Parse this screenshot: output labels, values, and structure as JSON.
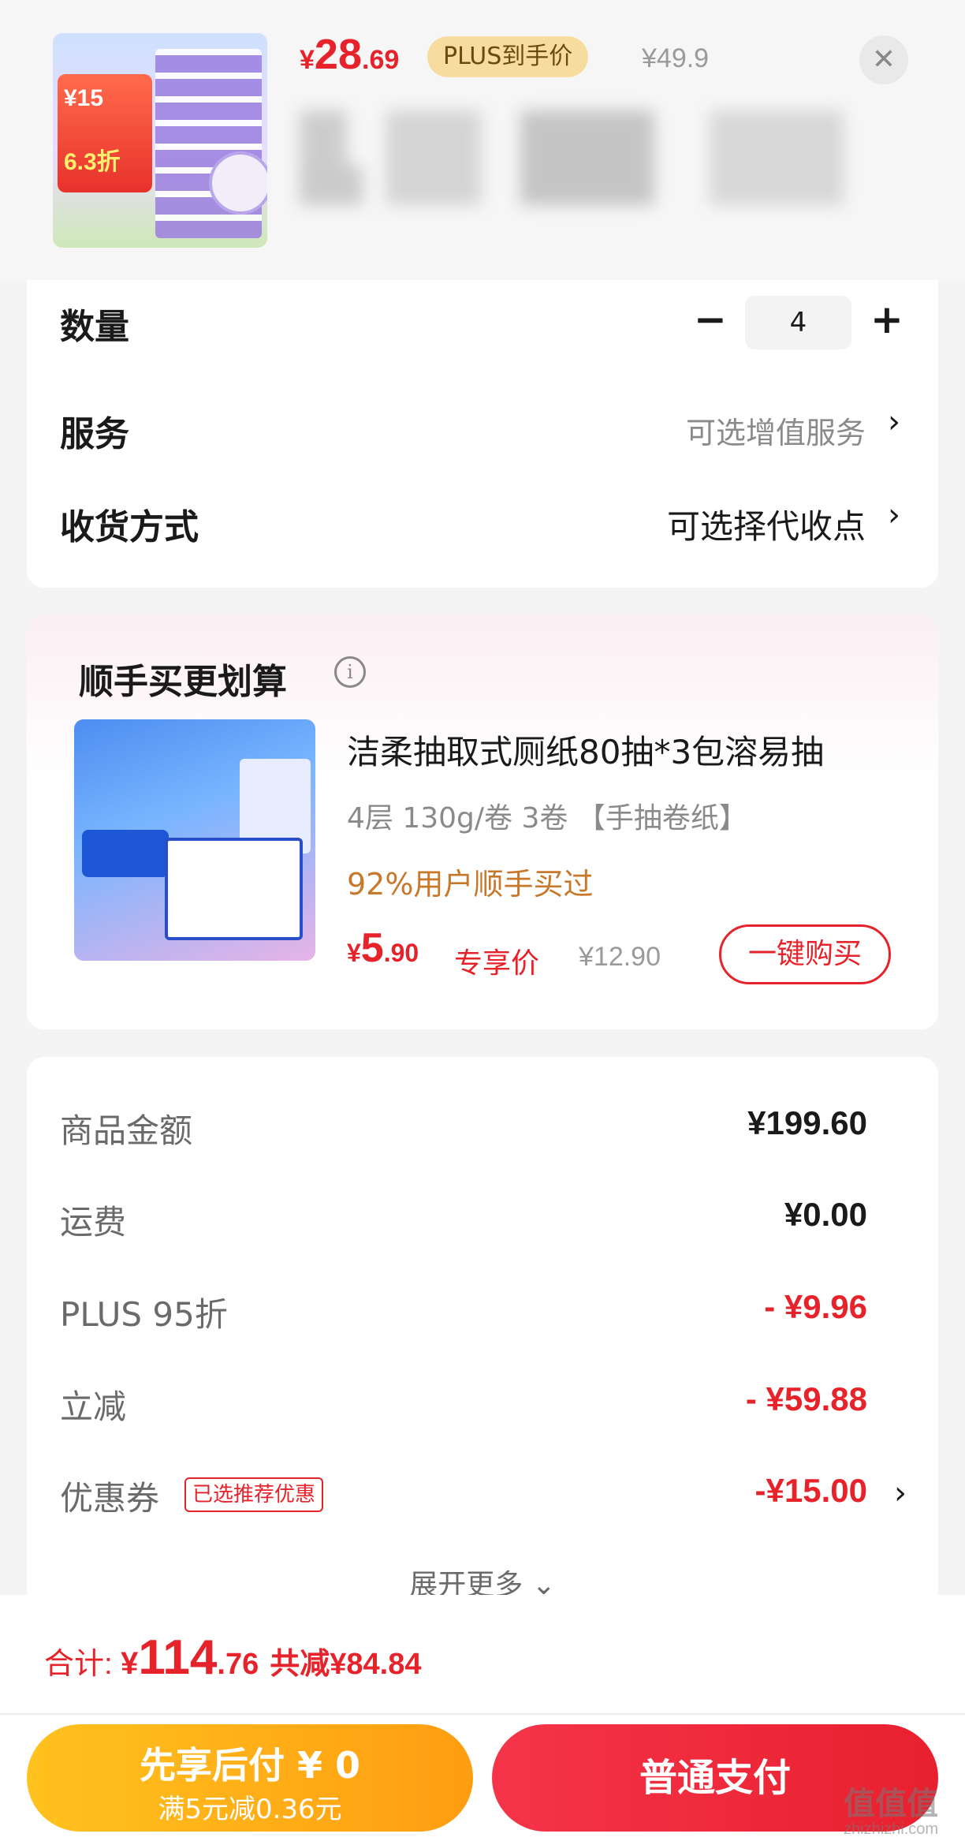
{
  "header": {
    "price_yen": "¥",
    "price_int": "28",
    "price_dec": ".69",
    "plus_tag": "PLUS到手价",
    "original_price": "¥49.9",
    "close_icon": "✕",
    "thumb_text_1": "¥15",
    "thumb_text_2": "6.3折"
  },
  "attributes": {
    "quantity_label": "数量",
    "quantity_minus": "−",
    "quantity_value": "4",
    "quantity_plus": "+",
    "service_label": "服务",
    "service_value": "可选增值服务",
    "delivery_label": "收货方式",
    "delivery_value": "可选择代收点",
    "chevron": "›"
  },
  "bundle": {
    "title": "顺手买更划算",
    "info_icon": "i",
    "name": "洁柔抽取式厕纸80抽*3包溶易抽",
    "spec": "4层 130g/卷 3卷 【手抽卷纸】",
    "social_proof": "92%用户顺手买过",
    "price_yen": "¥",
    "price_int": "5",
    "price_dec": ".90",
    "exclusive_label": "专享价",
    "original_price": "¥12.90",
    "buy_button": "一键购买"
  },
  "summary": {
    "rows": [
      {
        "label": "商品金额",
        "value": "¥199.60"
      },
      {
        "label": "运费",
        "value": "¥0.00"
      },
      {
        "label": "PLUS 95折",
        "value": "- ¥9.96"
      },
      {
        "label": "立减",
        "value": "- ¥59.88"
      },
      {
        "label": "优惠券",
        "value": "-¥15.00"
      }
    ],
    "coupon_tag": "已选推荐优惠",
    "expand_more": "展开更多 ⌄"
  },
  "footer": {
    "total_label": "合计: ",
    "total_yen": "¥",
    "total_int": "114",
    "total_dec": ".76",
    "saved": "共减¥84.84",
    "pay_later_line1": "先享后付 ¥ 0",
    "pay_later_line2": "满5元减0.36元",
    "pay_button": "普通支付"
  },
  "watermark": {
    "line1": "值值值",
    "line2": "zhizhizhi.com"
  },
  "colors": {
    "accent_red": "#e6232a",
    "plus_gold": "#f7dca0",
    "pay_later_orange": "#ffb31a",
    "social_orange": "#c8782a"
  }
}
